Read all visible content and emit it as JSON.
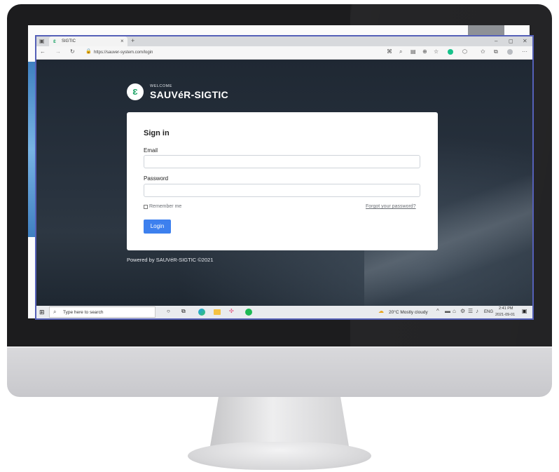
{
  "browser": {
    "tab_title": "SIGTIC",
    "tab_icon": "sigtic-favicon-icon",
    "new_tab": "+",
    "close_tab": "×",
    "url": "https://sauver-system.com/login",
    "window_controls": [
      "–",
      "◻",
      "✕"
    ],
    "toolbar_icons": [
      "apps-icon",
      "search-icon",
      "reader-icon",
      "zoom-icon",
      "favorite-add-icon",
      "grammarly-icon",
      "extension-icon",
      "favorites-icon",
      "collections-icon",
      "profile-icon",
      "more-icon"
    ]
  },
  "brand": {
    "welcome": "WELCOME",
    "name": "SAUVéR-SIGTIC",
    "logo_letter": "ɛ",
    "accent": "#22a66a"
  },
  "form": {
    "title": "Sign in",
    "email_label": "Email",
    "email_value": "",
    "password_label": "Password",
    "password_value": "",
    "remember_label": "Remember me",
    "forgot_link": "Forgot your password?",
    "login_button": "Login",
    "button_color": "#3d80ee"
  },
  "footer": {
    "powered": "Powered by SAUVéR-SIGTIC ©2021"
  },
  "taskbar": {
    "search_placeholder": "Type here to search",
    "weather": "20°C  Mostly cloudy",
    "language": "ENG",
    "time": "2:41 PM",
    "date": "2021-09-01"
  }
}
